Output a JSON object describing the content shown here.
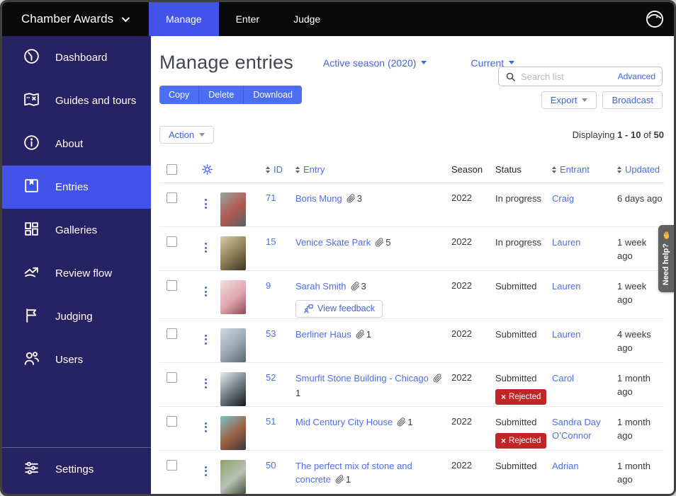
{
  "colors": {
    "accent_blue": "#4353e9",
    "link_blue": "#4c6ef5",
    "sidebar_navy": "#272264",
    "topbar_black": "#0a0a0a",
    "rejected_red": "#c22525",
    "help_tab_gray": "#616161"
  },
  "topbar": {
    "brand": "Chamber Awards",
    "tabs": [
      {
        "label": "Manage",
        "active": true
      },
      {
        "label": "Enter",
        "active": false
      },
      {
        "label": "Judge",
        "active": false
      }
    ]
  },
  "sidebar": {
    "items": [
      {
        "label": "Dashboard",
        "icon": "dashboard-icon",
        "active": false
      },
      {
        "label": "Guides and tours",
        "icon": "map-icon",
        "active": false
      },
      {
        "label": "About",
        "icon": "info-icon",
        "active": false
      },
      {
        "label": "Entries",
        "icon": "bookmark-icon",
        "active": true
      },
      {
        "label": "Galleries",
        "icon": "grid-icon",
        "active": false
      },
      {
        "label": "Review flow",
        "icon": "flow-arrow-icon",
        "active": false
      },
      {
        "label": "Judging",
        "icon": "flag-icon",
        "active": false
      },
      {
        "label": "Users",
        "icon": "users-icon",
        "active": false
      }
    ],
    "settings": {
      "label": "Settings",
      "icon": "sliders-icon"
    }
  },
  "header": {
    "title": "Manage entries",
    "season_selector": "Active season (2020)",
    "filter_selector": "Current",
    "search": {
      "placeholder": "Search list",
      "advanced_label": "Advanced"
    },
    "bulk_buttons": {
      "copy": "Copy",
      "delete": "Delete",
      "download": "Download"
    },
    "export_label": "Export",
    "broadcast_label": "Broadcast",
    "action_label": "Action",
    "displaying": {
      "prefix": "Displaying",
      "range": "1 - 10",
      "of": "of",
      "total": "50"
    }
  },
  "table": {
    "columns": [
      {
        "label": "ID",
        "sortable": true
      },
      {
        "label": "Entry",
        "sortable": true
      },
      {
        "label": "Season",
        "sortable": false
      },
      {
        "label": "Status",
        "sortable": false
      },
      {
        "label": "Entrant",
        "sortable": true
      },
      {
        "label": "Updated",
        "sortable": true
      }
    ],
    "rejected_label": "Rejected",
    "rows": [
      {
        "id": "71",
        "title": "Boris Mung",
        "attachments": "3",
        "season": "2022",
        "status": "In progress",
        "rejected": false,
        "entrant": "Craig",
        "updated": "6 days ago",
        "thumb": [
          "#9aa4a0",
          "#b0584e",
          "#51626a"
        ]
      },
      {
        "id": "15",
        "title": "Venice Skate Park",
        "attachments": "5",
        "season": "2022",
        "status": "In progress",
        "rejected": false,
        "entrant": "Lauren",
        "updated": "1 week ago",
        "thumb": [
          "#d9cba4",
          "#8a7a52",
          "#3b3425"
        ]
      },
      {
        "id": "9",
        "title": "Sarah Smith",
        "attachments": "3",
        "season": "2022",
        "status": "Submitted",
        "rejected": false,
        "entrant": "Lauren",
        "updated": "1 week ago",
        "feedback_button": "View feedback",
        "thumb": [
          "#f0dede",
          "#e0a4ad",
          "#8c4a56"
        ]
      },
      {
        "id": "53",
        "title": "Berliner Haus",
        "attachments": "1",
        "season": "2022",
        "status": "Submitted",
        "rejected": false,
        "entrant": "Lauren",
        "updated": "4 weeks ago",
        "thumb": [
          "#cfdbe2",
          "#97a6b0",
          "#5c666e"
        ]
      },
      {
        "id": "52",
        "title": "Smurfit Stone Building - Chicago",
        "attachments": "1",
        "season": "2022",
        "status": "Submitted",
        "rejected": true,
        "entrant": "Carol",
        "updated": "1 month ago",
        "thumb": [
          "#e8ebee",
          "#6a737c",
          "#16181c"
        ]
      },
      {
        "id": "51",
        "title": "Mid Century City House",
        "attachments": "1",
        "season": "2022",
        "status": "Submitted",
        "rejected": true,
        "entrant": "Sandra Day O’Connor",
        "updated": "1 month ago",
        "thumb": [
          "#7cc4cc",
          "#9c5e40",
          "#343841"
        ]
      },
      {
        "id": "50",
        "title": "The perfect mix of stone and concrete",
        "attachments": "1",
        "season": "2022",
        "status": "Submitted",
        "rejected": false,
        "entrant": "Adrian",
        "updated": "1 month ago",
        "thumb": [
          "#8aa468",
          "#b9c0b4",
          "#45523a"
        ]
      }
    ]
  },
  "help_tab": {
    "label": "Need help?",
    "icon": "waving-hand-icon"
  }
}
